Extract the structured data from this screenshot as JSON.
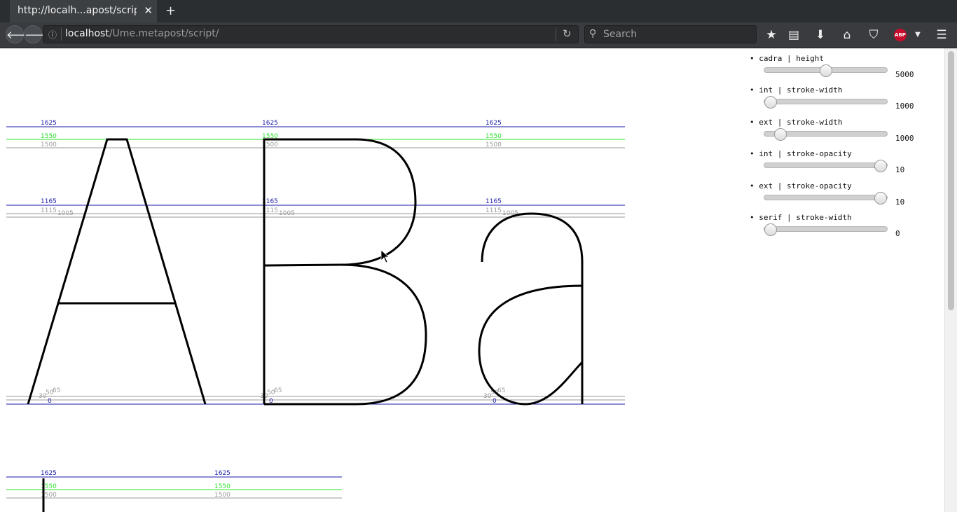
{
  "browser": {
    "tab_title": "http://localh...apost/script/",
    "tab_close_icon": "close-icon",
    "new_tab_icon": "plus-icon",
    "url_host": "localhost",
    "url_path": "/Ume.metapost/script/",
    "search_placeholder": "Search",
    "toolbar_icons": [
      "bookmark-star-icon",
      "reading-list-icon",
      "download-icon",
      "home-icon",
      "pocket-icon",
      "adblock-icon",
      "menu-icon"
    ],
    "abp_text": "ABP"
  },
  "panel": {
    "controls": [
      {
        "label": "cadra | height",
        "value": "5000",
        "fraction": 0.5
      },
      {
        "label": "int | stroke-width",
        "value": "1000",
        "fraction": 0.0
      },
      {
        "label": "ext | stroke-width",
        "value": "1000",
        "fraction": 0.09
      },
      {
        "label": "int | stroke-opacity",
        "value": "10",
        "fraction": 1.0
      },
      {
        "label": "ext | stroke-opacity",
        "value": "10",
        "fraction": 1.0
      },
      {
        "label": "serif | stroke-width",
        "value": "0",
        "fraction": 0.0
      }
    ]
  },
  "glyph_rows": [
    {
      "glyphs": [
        "A",
        "B",
        "a"
      ],
      "guides": {
        "l1625": "1625",
        "l1550": "1550",
        "l1500": "1500",
        "l1165": "1165",
        "l1115": "1115",
        "l1005": "1005",
        "l65": "65",
        "l50": "50",
        "l30": "30",
        "l0": "0"
      }
    },
    {
      "guides": {
        "l1625": "1625",
        "l1550": "1550",
        "l1500": "1500"
      }
    }
  ],
  "colors": {
    "guide_blue": "#1a1aa8",
    "guide_green": "#2de02d",
    "guide_gray": "#999999",
    "glyph_stroke": "#000000"
  }
}
